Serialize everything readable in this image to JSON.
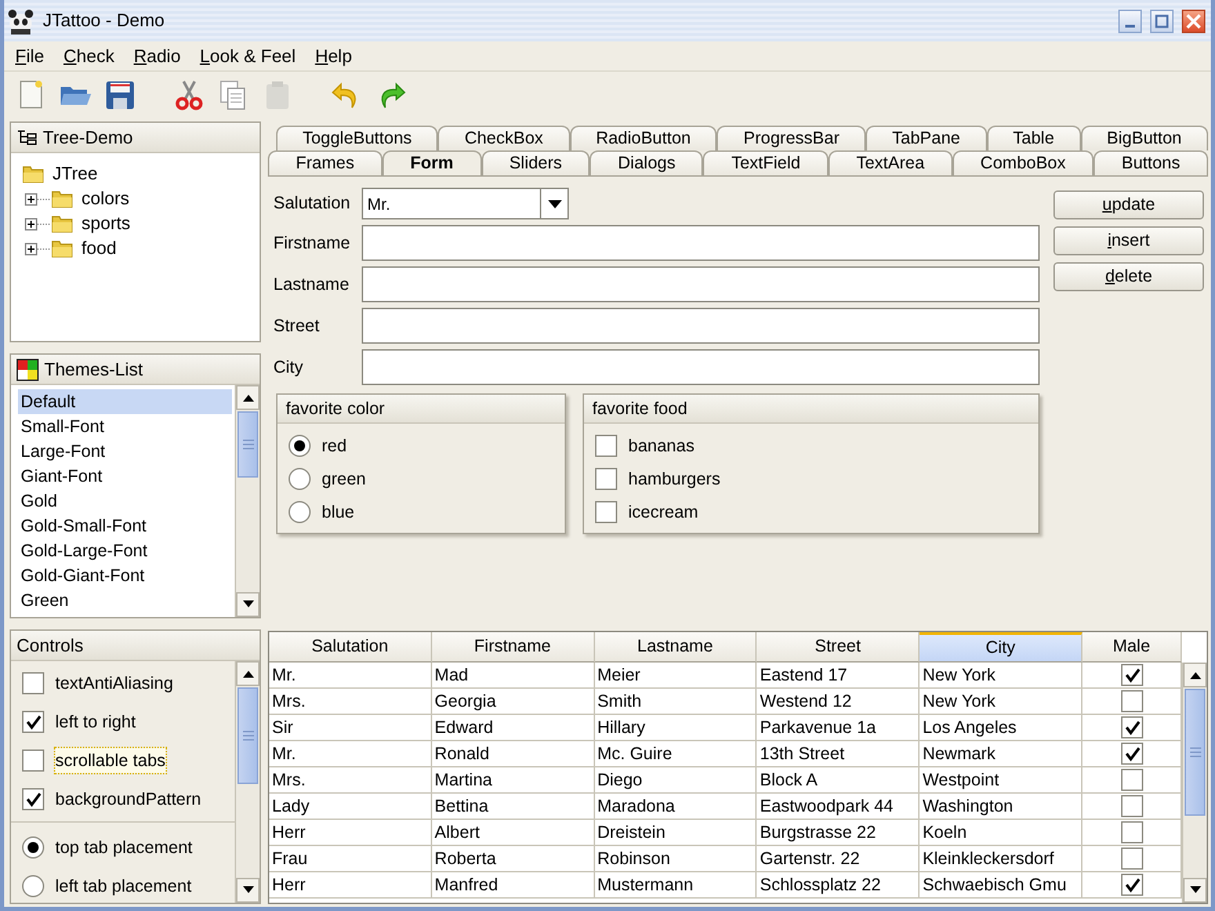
{
  "window": {
    "title": "JTattoo - Demo"
  },
  "menu": [
    "File",
    "Check",
    "Radio",
    "Look & Feel",
    "Help"
  ],
  "toolbar": [
    {
      "kind": "new",
      "disabled": false
    },
    {
      "kind": "open",
      "disabled": false
    },
    {
      "kind": "save",
      "disabled": false
    },
    {
      "kind": "cut",
      "disabled": false
    },
    {
      "kind": "copy",
      "disabled": false
    },
    {
      "kind": "paste",
      "disabled": true
    },
    {
      "kind": "undo",
      "disabled": false
    },
    {
      "kind": "redo",
      "disabled": false
    }
  ],
  "tree_panel": {
    "title": "Tree-Demo",
    "root": {
      "label": "JTree",
      "children": [
        {
          "label": "colors",
          "expanded": false
        },
        {
          "label": "sports",
          "expanded": false
        },
        {
          "label": "food",
          "expanded": false
        }
      ]
    }
  },
  "themes_panel": {
    "title": "Themes-List",
    "items": [
      {
        "label": "Default",
        "selected": true
      },
      {
        "label": "Small-Font",
        "selected": false
      },
      {
        "label": "Large-Font",
        "selected": false
      },
      {
        "label": "Giant-Font",
        "selected": false
      },
      {
        "label": "Gold",
        "selected": false
      },
      {
        "label": "Gold-Small-Font",
        "selected": false
      },
      {
        "label": "Gold-Large-Font",
        "selected": false
      },
      {
        "label": "Gold-Giant-Font",
        "selected": false
      },
      {
        "label": "Green",
        "selected": false
      }
    ]
  },
  "controls_panel": {
    "title": "Controls",
    "items": [
      {
        "kind": "checkbox",
        "label": "textAntiAliasing",
        "checked": false,
        "focused": false
      },
      {
        "kind": "checkbox",
        "label": "left to right",
        "checked": true,
        "focused": false
      },
      {
        "kind": "checkbox",
        "label": "scrollable tabs",
        "checked": false,
        "focused": true
      },
      {
        "kind": "checkbox",
        "label": "backgroundPattern",
        "checked": true,
        "focused": false
      },
      {
        "kind": "radio",
        "label": "top tab placement",
        "checked": true,
        "focused": false
      },
      {
        "kind": "radio",
        "label": "left tab placement",
        "checked": false,
        "focused": false
      }
    ]
  },
  "tabs": [
    [
      {
        "label": "ToggleButtons",
        "selected": false
      },
      {
        "label": "CheckBox",
        "selected": false
      },
      {
        "label": "RadioButton",
        "selected": false
      },
      {
        "label": "ProgressBar",
        "selected": false
      },
      {
        "label": "TabPane",
        "selected": false
      },
      {
        "label": "Table",
        "selected": false
      },
      {
        "label": "BigButton",
        "selected": false
      }
    ],
    [
      {
        "label": "Frames",
        "selected": false
      },
      {
        "label": "Form",
        "selected": true
      },
      {
        "label": "Sliders",
        "selected": false
      },
      {
        "label": "Dialogs",
        "selected": false
      },
      {
        "label": "TextField",
        "selected": false
      },
      {
        "label": "TextArea",
        "selected": false
      },
      {
        "label": "ComboBox",
        "selected": false
      },
      {
        "label": "Buttons",
        "selected": false
      }
    ]
  ],
  "form": {
    "fields": [
      {
        "kind": "combo",
        "label": "Salutation",
        "value": "Mr."
      },
      {
        "kind": "text",
        "label": "Firstname"
      },
      {
        "kind": "text",
        "label": "Lastname"
      },
      {
        "kind": "text",
        "label": "Street"
      },
      {
        "kind": "text",
        "label": "City"
      }
    ],
    "buttons": [
      "update",
      "insert",
      "delete"
    ],
    "groups": [
      {
        "title": "favorite color",
        "kind": "radio",
        "options": [
          {
            "label": "red",
            "checked": true
          },
          {
            "label": "green",
            "checked": false
          },
          {
            "label": "blue",
            "checked": false
          }
        ]
      },
      {
        "title": "favorite food",
        "kind": "checkbox",
        "options": [
          {
            "label": "bananas",
            "checked": false
          },
          {
            "label": "hamburgers",
            "checked": false
          },
          {
            "label": "icecream",
            "checked": false
          }
        ]
      }
    ]
  },
  "table": {
    "columns": [
      {
        "label": "Salutation",
        "selected": false
      },
      {
        "label": "Firstname",
        "selected": false
      },
      {
        "label": "Lastname",
        "selected": false
      },
      {
        "label": "Street",
        "selected": false
      },
      {
        "label": "City",
        "selected": true
      },
      {
        "label": "Male",
        "selected": false
      }
    ],
    "rows": [
      {
        "cells": [
          "Mr.",
          "Mad",
          "Meier",
          "Eastend 17",
          "New York"
        ],
        "male": true
      },
      {
        "cells": [
          "Mrs.",
          "Georgia",
          "Smith",
          "Westend 12",
          "New York"
        ],
        "male": false
      },
      {
        "cells": [
          "Sir",
          "Edward",
          "Hillary",
          "Parkavenue 1a",
          "Los Angeles"
        ],
        "male": true
      },
      {
        "cells": [
          "Mr.",
          "Ronald",
          "Mc. Guire",
          "13th Street",
          "Newmark"
        ],
        "male": true
      },
      {
        "cells": [
          "Mrs.",
          "Martina",
          "Diego",
          "Block A",
          "Westpoint"
        ],
        "male": false
      },
      {
        "cells": [
          "Lady",
          "Bettina",
          "Maradona",
          "Eastwoodpark 44",
          "Washington"
        ],
        "male": false
      },
      {
        "cells": [
          "Herr",
          "Albert",
          "Dreistein",
          "Burgstrasse 22",
          "Koeln"
        ],
        "male": false
      },
      {
        "cells": [
          "Frau",
          "Roberta",
          "Robinson",
          "Gartenstr. 22",
          "Kleinkleckersdorf"
        ],
        "male": false
      },
      {
        "cells": [
          "Herr",
          "Manfred",
          "Mustermann",
          "Schlossplatz 22",
          "Schwaebisch Gmu"
        ],
        "male": true
      }
    ]
  }
}
